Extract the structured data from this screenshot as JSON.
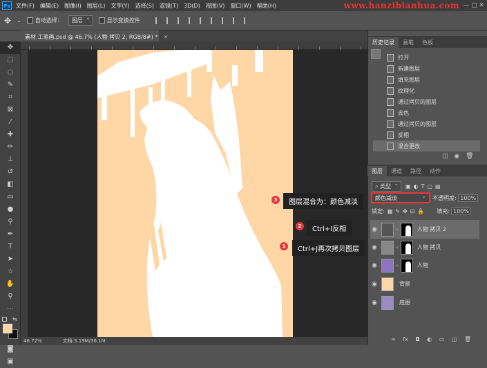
{
  "menu": {
    "app_icon": "Ps",
    "items": [
      "文件(F)",
      "编辑(E)",
      "图像(I)",
      "图层(L)",
      "文字(Y)",
      "选择(S)",
      "滤镜(T)",
      "3D(D)",
      "视图(V)",
      "窗口(W)",
      "帮助(H)"
    ],
    "watermark": "www.hanzibianhua.com"
  },
  "options": {
    "auto_select_label": "自动选择：",
    "auto_select_value": "图层",
    "show_transform_label": "显示变换控件"
  },
  "document": {
    "tab_title": "素材 工笔画.psd @ 46.7% (人物 拷贝 2, RGB/8#) *"
  },
  "status": {
    "zoom": "46.72%",
    "doc_size": "文档:3.19M/36.1M"
  },
  "annotations": [
    {
      "badge": "3",
      "text": "图层混合为：颜色减淡"
    },
    {
      "badge": "2",
      "text": "Ctrl+I反相"
    },
    {
      "badge": "1",
      "text": "Ctrl+J再次拷贝图层"
    }
  ],
  "history_panel": {
    "tabs": [
      "历史记录",
      "画笔",
      "色板"
    ],
    "items": [
      "打开",
      "新建图层",
      "填充图层",
      "纹理化",
      "通过拷贝的图层",
      "去色",
      "通过拷贝的图层",
      "反相",
      "混合更改"
    ],
    "selected_index": 8
  },
  "layers_panel": {
    "tabs": [
      "图层",
      "通道",
      "路径",
      "动作"
    ],
    "filter_label": "类型",
    "blend_mode": "颜色减淡",
    "opacity_label": "不透明度:",
    "opacity_value": "100%",
    "lock_label": "锁定:",
    "fill_label": "填充:",
    "fill_value": "100%",
    "layers": [
      {
        "name": "人物 拷贝 2",
        "thumb_color": "#555555",
        "has_mask": true,
        "selected": true
      },
      {
        "name": "人物 拷贝",
        "thumb_color": "#888888",
        "has_mask": true,
        "selected": false
      },
      {
        "name": "人物",
        "thumb_color": "#8a76c4",
        "has_mask": true,
        "selected": false
      },
      {
        "name": "背景",
        "thumb_color": "#ffd6a5",
        "has_mask": false,
        "selected": false
      },
      {
        "name": "底图",
        "thumb_color": "#9b8ac8",
        "has_mask": false,
        "selected": false
      }
    ]
  },
  "colors": {
    "foreground": "#ffd6a5",
    "background": "#111111",
    "canvas_fill": "#ffd6a5",
    "accent_red": "#e5383b"
  }
}
